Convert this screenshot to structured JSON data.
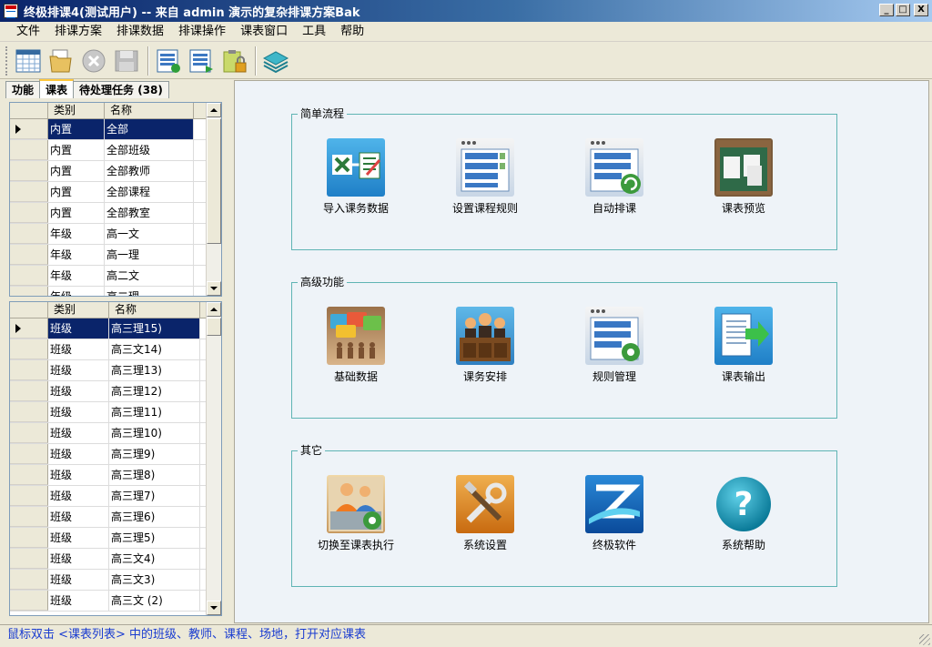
{
  "window": {
    "title": "终极排课4(测试用户) -- 来自 admin 演示的复杂排课方案Bak",
    "minimize": "_",
    "maximize": "□",
    "close": "X"
  },
  "menu": [
    "文件",
    "排课方案",
    "排课数据",
    "排课操作",
    "课表窗口",
    "工具",
    "帮助"
  ],
  "toolbar_icons": [
    "calendar-table-icon",
    "open-folder-icon",
    "cancel-icon",
    "save-icon",
    "import-list-icon",
    "export-list-icon",
    "lock-clipboard-icon",
    "layers-icon"
  ],
  "tabs": [
    "功能",
    "课表",
    "待处理任务 (38)"
  ],
  "active_tab": 1,
  "grid_top": {
    "headers": [
      "类别",
      "名称"
    ],
    "rows": [
      [
        "内置",
        "全部"
      ],
      [
        "内置",
        "全部班级"
      ],
      [
        "内置",
        "全部教师"
      ],
      [
        "内置",
        "全部课程"
      ],
      [
        "内置",
        "全部教室"
      ],
      [
        "年级",
        "高一文"
      ],
      [
        "年级",
        "高一理"
      ],
      [
        "年级",
        "高二文"
      ],
      [
        "年级",
        "高二理"
      ]
    ]
  },
  "grid_bottom": {
    "headers": [
      "类别",
      "名称"
    ],
    "rows": [
      [
        "班级",
        "高三理15)"
      ],
      [
        "班级",
        "高三文14)"
      ],
      [
        "班级",
        "高三理13)"
      ],
      [
        "班级",
        "高三理12)"
      ],
      [
        "班级",
        "高三理11)"
      ],
      [
        "班级",
        "高三理10)"
      ],
      [
        "班级",
        "高三理9)"
      ],
      [
        "班级",
        "高三理8)"
      ],
      [
        "班级",
        "高三理7)"
      ],
      [
        "班级",
        "高三理6)"
      ],
      [
        "班级",
        "高三理5)"
      ],
      [
        "班级",
        "高三文4)"
      ],
      [
        "班级",
        "高三文3)"
      ],
      [
        "班级",
        "高三文 (2)"
      ]
    ]
  },
  "groups": [
    {
      "title": "简单流程",
      "items": [
        {
          "label": "导入课务数据",
          "icon": "import-excel-icon"
        },
        {
          "label": "设置课程规则",
          "icon": "rule-list-icon"
        },
        {
          "label": "自动排课",
          "icon": "auto-schedule-icon"
        },
        {
          "label": "课表预览",
          "icon": "preview-board-icon"
        }
      ]
    },
    {
      "title": "高级功能",
      "items": [
        {
          "label": "基础数据",
          "icon": "base-data-icon"
        },
        {
          "label": "课务安排",
          "icon": "teachers-icon"
        },
        {
          "label": "规则管理",
          "icon": "rule-manage-icon"
        },
        {
          "label": "课表输出",
          "icon": "export-document-icon"
        }
      ]
    },
    {
      "title": "其它",
      "items": [
        {
          "label": "切换至课表执行",
          "icon": "switch-user-icon"
        },
        {
          "label": "系统设置",
          "icon": "tools-icon"
        },
        {
          "label": "终极软件",
          "icon": "brand-logo-icon"
        },
        {
          "label": "系统帮助",
          "icon": "help-icon"
        }
      ]
    }
  ],
  "status": "鼠标双击 <课表列表> 中的班级、教师、课程、场地，打开对应课表"
}
